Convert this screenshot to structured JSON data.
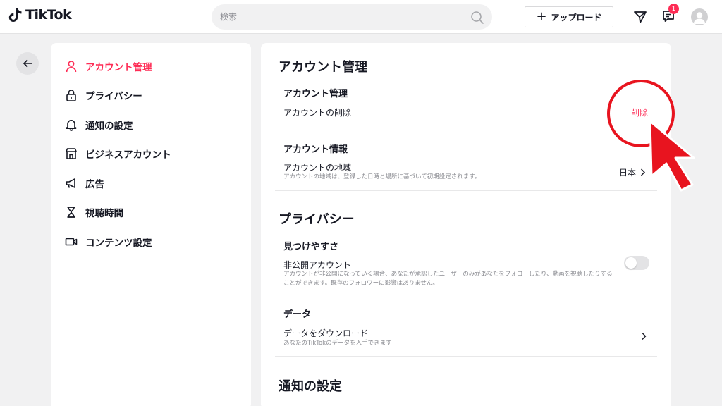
{
  "header": {
    "logo_text": "TikTok",
    "search": {
      "placeholder": "検索"
    },
    "upload_label": "アップロード",
    "notification_badge": "1"
  },
  "sidebar": {
    "items": [
      {
        "label": "アカウント管理",
        "icon": "person-icon",
        "active": true
      },
      {
        "label": "プライバシー",
        "icon": "lock-icon",
        "active": false
      },
      {
        "label": "通知の設定",
        "icon": "bell-icon",
        "active": false
      },
      {
        "label": "ビジネスアカウント",
        "icon": "store-icon",
        "active": false
      },
      {
        "label": "広告",
        "icon": "megaphone-icon",
        "active": false
      },
      {
        "label": "視聴時間",
        "icon": "hourglass-icon",
        "active": false
      },
      {
        "label": "コンテンツ設定",
        "icon": "video-camera-icon",
        "active": false
      }
    ]
  },
  "main": {
    "account_section": {
      "title": "アカウント管理",
      "manage_subtitle": "アカウント管理",
      "delete_label": "アカウントの削除",
      "delete_action": "削除",
      "info_subtitle": "アカウント情報",
      "region_label": "アカウントの地域",
      "region_desc": "アカウントの地域は、登録した日時と場所に基づいて初期設定されます。",
      "region_value": "日本"
    },
    "privacy_section": {
      "title": "プライバシー",
      "discover_subtitle": "見つけやすさ",
      "private_label": "非公開アカウント",
      "private_desc": "アカウントが非公開になっている場合、あなたが承認したユーザーのみがあなたをフォローしたり、動画を視聴したりすることができます。既存のフォロワーに影響はありません。",
      "private_enabled": false,
      "data_subtitle": "データ",
      "download_label": "データをダウンロード",
      "download_desc": "あなたのTikTokのデータを入手できます"
    },
    "notifications_section": {
      "title": "通知の設定"
    }
  },
  "colors": {
    "accent": "#fe2c55",
    "annotation": "#e8141f",
    "page_bg": "#f1f1f2"
  }
}
